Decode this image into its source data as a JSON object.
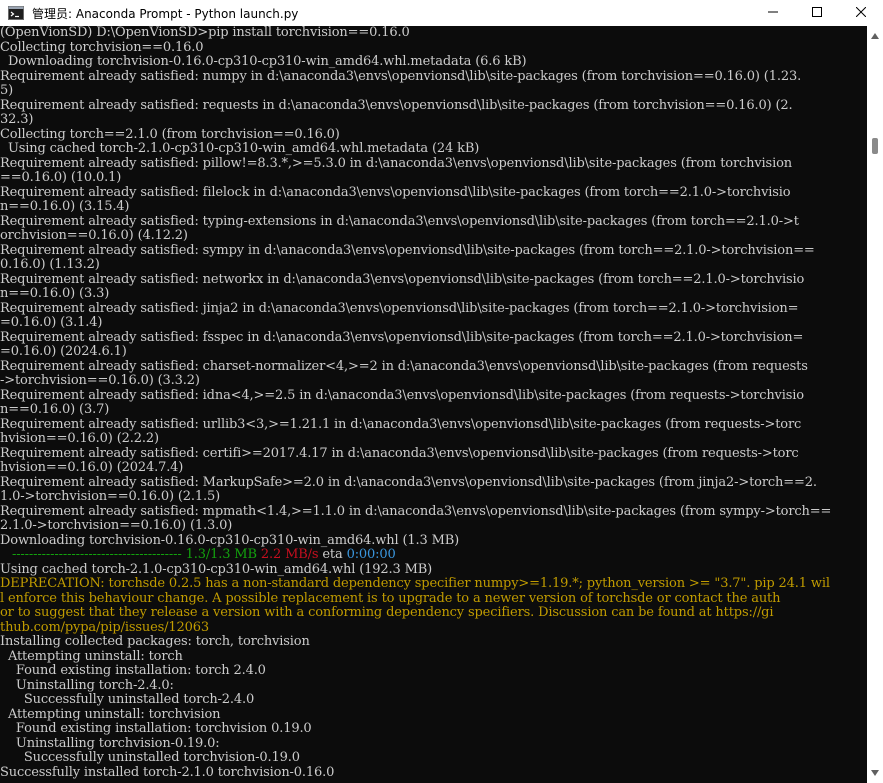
{
  "window": {
    "title": "管理员: Anaconda Prompt - Python  launch.py",
    "icon": "terminal-icon",
    "controls": [
      "minimize-icon",
      "maximize-icon",
      "close-icon"
    ]
  },
  "terminal": {
    "lines": [
      "(OpenVionSD) D:\\OpenVionSD>pip install torchvision==0.16.0",
      "Collecting torchvision==0.16.0",
      "  Downloading torchvision-0.16.0-cp310-cp310-win_amd64.whl.metadata (6.6 kB)",
      "Requirement already satisfied: numpy in d:\\anaconda3\\envs\\openvionsd\\lib\\site-packages (from torchvision==0.16.0) (1.23.",
      "5)",
      "Requirement already satisfied: requests in d:\\anaconda3\\envs\\openvionsd\\lib\\site-packages (from torchvision==0.16.0) (2.",
      "32.3)",
      "Collecting torch==2.1.0 (from torchvision==0.16.0)",
      "  Using cached torch-2.1.0-cp310-cp310-win_amd64.whl.metadata (24 kB)",
      "Requirement already satisfied: pillow!=8.3.*,>=5.3.0 in d:\\anaconda3\\envs\\openvionsd\\lib\\site-packages (from torchvision",
      "==0.16.0) (10.0.1)",
      "Requirement already satisfied: filelock in d:\\anaconda3\\envs\\openvionsd\\lib\\site-packages (from torch==2.1.0->torchvisio",
      "n==0.16.0) (3.15.4)",
      "Requirement already satisfied: typing-extensions in d:\\anaconda3\\envs\\openvionsd\\lib\\site-packages (from torch==2.1.0->t",
      "orchvision==0.16.0) (4.12.2)",
      "Requirement already satisfied: sympy in d:\\anaconda3\\envs\\openvionsd\\lib\\site-packages (from torch==2.1.0->torchvision==",
      "0.16.0) (1.13.2)",
      "Requirement already satisfied: networkx in d:\\anaconda3\\envs\\openvionsd\\lib\\site-packages (from torch==2.1.0->torchvisio",
      "n==0.16.0) (3.3)",
      "Requirement already satisfied: jinja2 in d:\\anaconda3\\envs\\openvionsd\\lib\\site-packages (from torch==2.1.0->torchvision=",
      "=0.16.0) (3.1.4)",
      "Requirement already satisfied: fsspec in d:\\anaconda3\\envs\\openvionsd\\lib\\site-packages (from torch==2.1.0->torchvision=",
      "=0.16.0) (2024.6.1)",
      "Requirement already satisfied: charset-normalizer<4,>=2 in d:\\anaconda3\\envs\\openvionsd\\lib\\site-packages (from requests",
      "->torchvision==0.16.0) (3.3.2)",
      "Requirement already satisfied: idna<4,>=2.5 in d:\\anaconda3\\envs\\openvionsd\\lib\\site-packages (from requests->torchvisio",
      "n==0.16.0) (3.7)",
      "Requirement already satisfied: urllib3<3,>=1.21.1 in d:\\anaconda3\\envs\\openvionsd\\lib\\site-packages (from requests->torc",
      "hvision==0.16.0) (2.2.2)",
      "Requirement already satisfied: certifi>=2017.4.17 in d:\\anaconda3\\envs\\openvionsd\\lib\\site-packages (from requests->torc",
      "hvision==0.16.0) (2024.7.4)",
      "Requirement already satisfied: MarkupSafe>=2.0 in d:\\anaconda3\\envs\\openvionsd\\lib\\site-packages (from jinja2->torch==2.",
      "1.0->torchvision==0.16.0) (2.1.5)",
      "Requirement already satisfied: mpmath<1.4,>=1.1.0 in d:\\anaconda3\\envs\\openvionsd\\lib\\site-packages (from sympy->torch==",
      "2.1.0->torchvision==0.16.0) (1.3.0)",
      "Downloading torchvision-0.16.0-cp310-cp310-win_amd64.whl (1.3 MB)"
    ],
    "progress": {
      "bar": "   ---------------------------------------- ",
      "done": "1.3/1.3 MB",
      "rate": "2.2 MB/s",
      "eta_label": " eta ",
      "eta": "0:00:00",
      "fraction": 1.0
    },
    "lines_after": [
      "Using cached torch-2.1.0-cp310-cp310-win_amd64.whl (192.3 MB)"
    ],
    "warning_lines": [
      "DEPRECATION: torchsde 0.2.5 has a non-standard dependency specifier numpy>=1.19.*; python_version >= \"3.7\". pip 24.1 wil",
      "l enforce this behaviour change. A possible replacement is to upgrade to a newer version of torchsde or contact the auth",
      "or to suggest that they release a version with a conforming dependency specifiers. Discussion can be found at https://gi",
      "thub.com/pypa/pip/issues/12063"
    ],
    "final_lines": [
      "Installing collected packages: torch, torchvision",
      "  Attempting uninstall: torch",
      "    Found existing installation: torch 2.4.0",
      "    Uninstalling torch-2.4.0:",
      "      Successfully uninstalled torch-2.4.0",
      "  Attempting uninstall: torchvision",
      "    Found existing installation: torchvision 0.19.0",
      "    Uninstalling torchvision-0.19.0:",
      "      Successfully uninstalled torchvision-0.19.0",
      "Successfully installed torch-2.1.0 torchvision-0.16.0"
    ]
  },
  "scrollbar": {
    "up_icon": "scroll-up-arrow-icon",
    "down_icon": "scroll-down-arrow-icon"
  }
}
